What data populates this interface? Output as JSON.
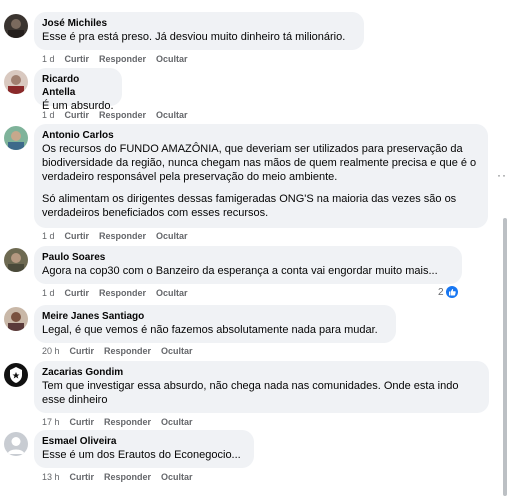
{
  "comments": [
    {
      "author": "José Michiles",
      "text": [
        "Esse é pra está preso. Já desviou muito dinheiro tá milionário."
      ],
      "time": "1 d",
      "like": "Curtir",
      "reply": "Responder",
      "hide": "Ocultar"
    },
    {
      "author": "Ricardo Antella",
      "text": [
        "É um absurdo."
      ],
      "time": "1 d",
      "like": "Curtir",
      "reply": "Responder",
      "hide": "Ocultar"
    },
    {
      "author": "Antonio Carlos",
      "text": [
        "Os recursos do FUNDO AMAZÔNIA, que deveriam ser utilizados para preservação da biodiversidade da região, nunca chegam nas mãos de quem realmente precisa e que é o verdadeiro responsável pela preservação do meio ambiente.",
        "Só alimentam os dirigentes dessas famigeradas ONG'S na maioria das vezes são os verdadeiros beneficiados com esses recursos."
      ],
      "time": "1 d",
      "like": "Curtir",
      "reply": "Responder",
      "hide": "Ocultar"
    },
    {
      "author": "Paulo Soares",
      "text": [
        "Agora na cop30 com o Banzeiro da esperança a conta vai engordar muito mais..."
      ],
      "time": "1 d",
      "like": "Curtir",
      "reply": "Responder",
      "hide": "Ocultar",
      "reaction_count": "2"
    },
    {
      "author": "Meire Janes Santiago",
      "text": [
        "Legal, é que vemos é não fazemos absolutamente nada para mudar."
      ],
      "time": "20 h",
      "like": "Curtir",
      "reply": "Responder",
      "hide": "Ocultar"
    },
    {
      "author": "Zacarias Gondim",
      "text": [
        "Tem que investigar essa absurdo, não chega nada nas comunidades. Onde esta indo esse dinheiro"
      ],
      "time": "17 h",
      "like": "Curtir",
      "reply": "Responder",
      "hide": "Ocultar"
    },
    {
      "author": "Esmael Oliveira",
      "text": [
        "Esse é um dos Erautos do Econegocio..."
      ],
      "time": "13 h",
      "like": "Curtir",
      "reply": "Responder",
      "hide": "Ocultar"
    }
  ],
  "more_options_icon": "ellipsis-icon",
  "reaction_icon": "like-icon",
  "colors": {
    "bubble": "#f0f2f5",
    "meta": "#65676b",
    "like_blue": "#1877f2"
  }
}
